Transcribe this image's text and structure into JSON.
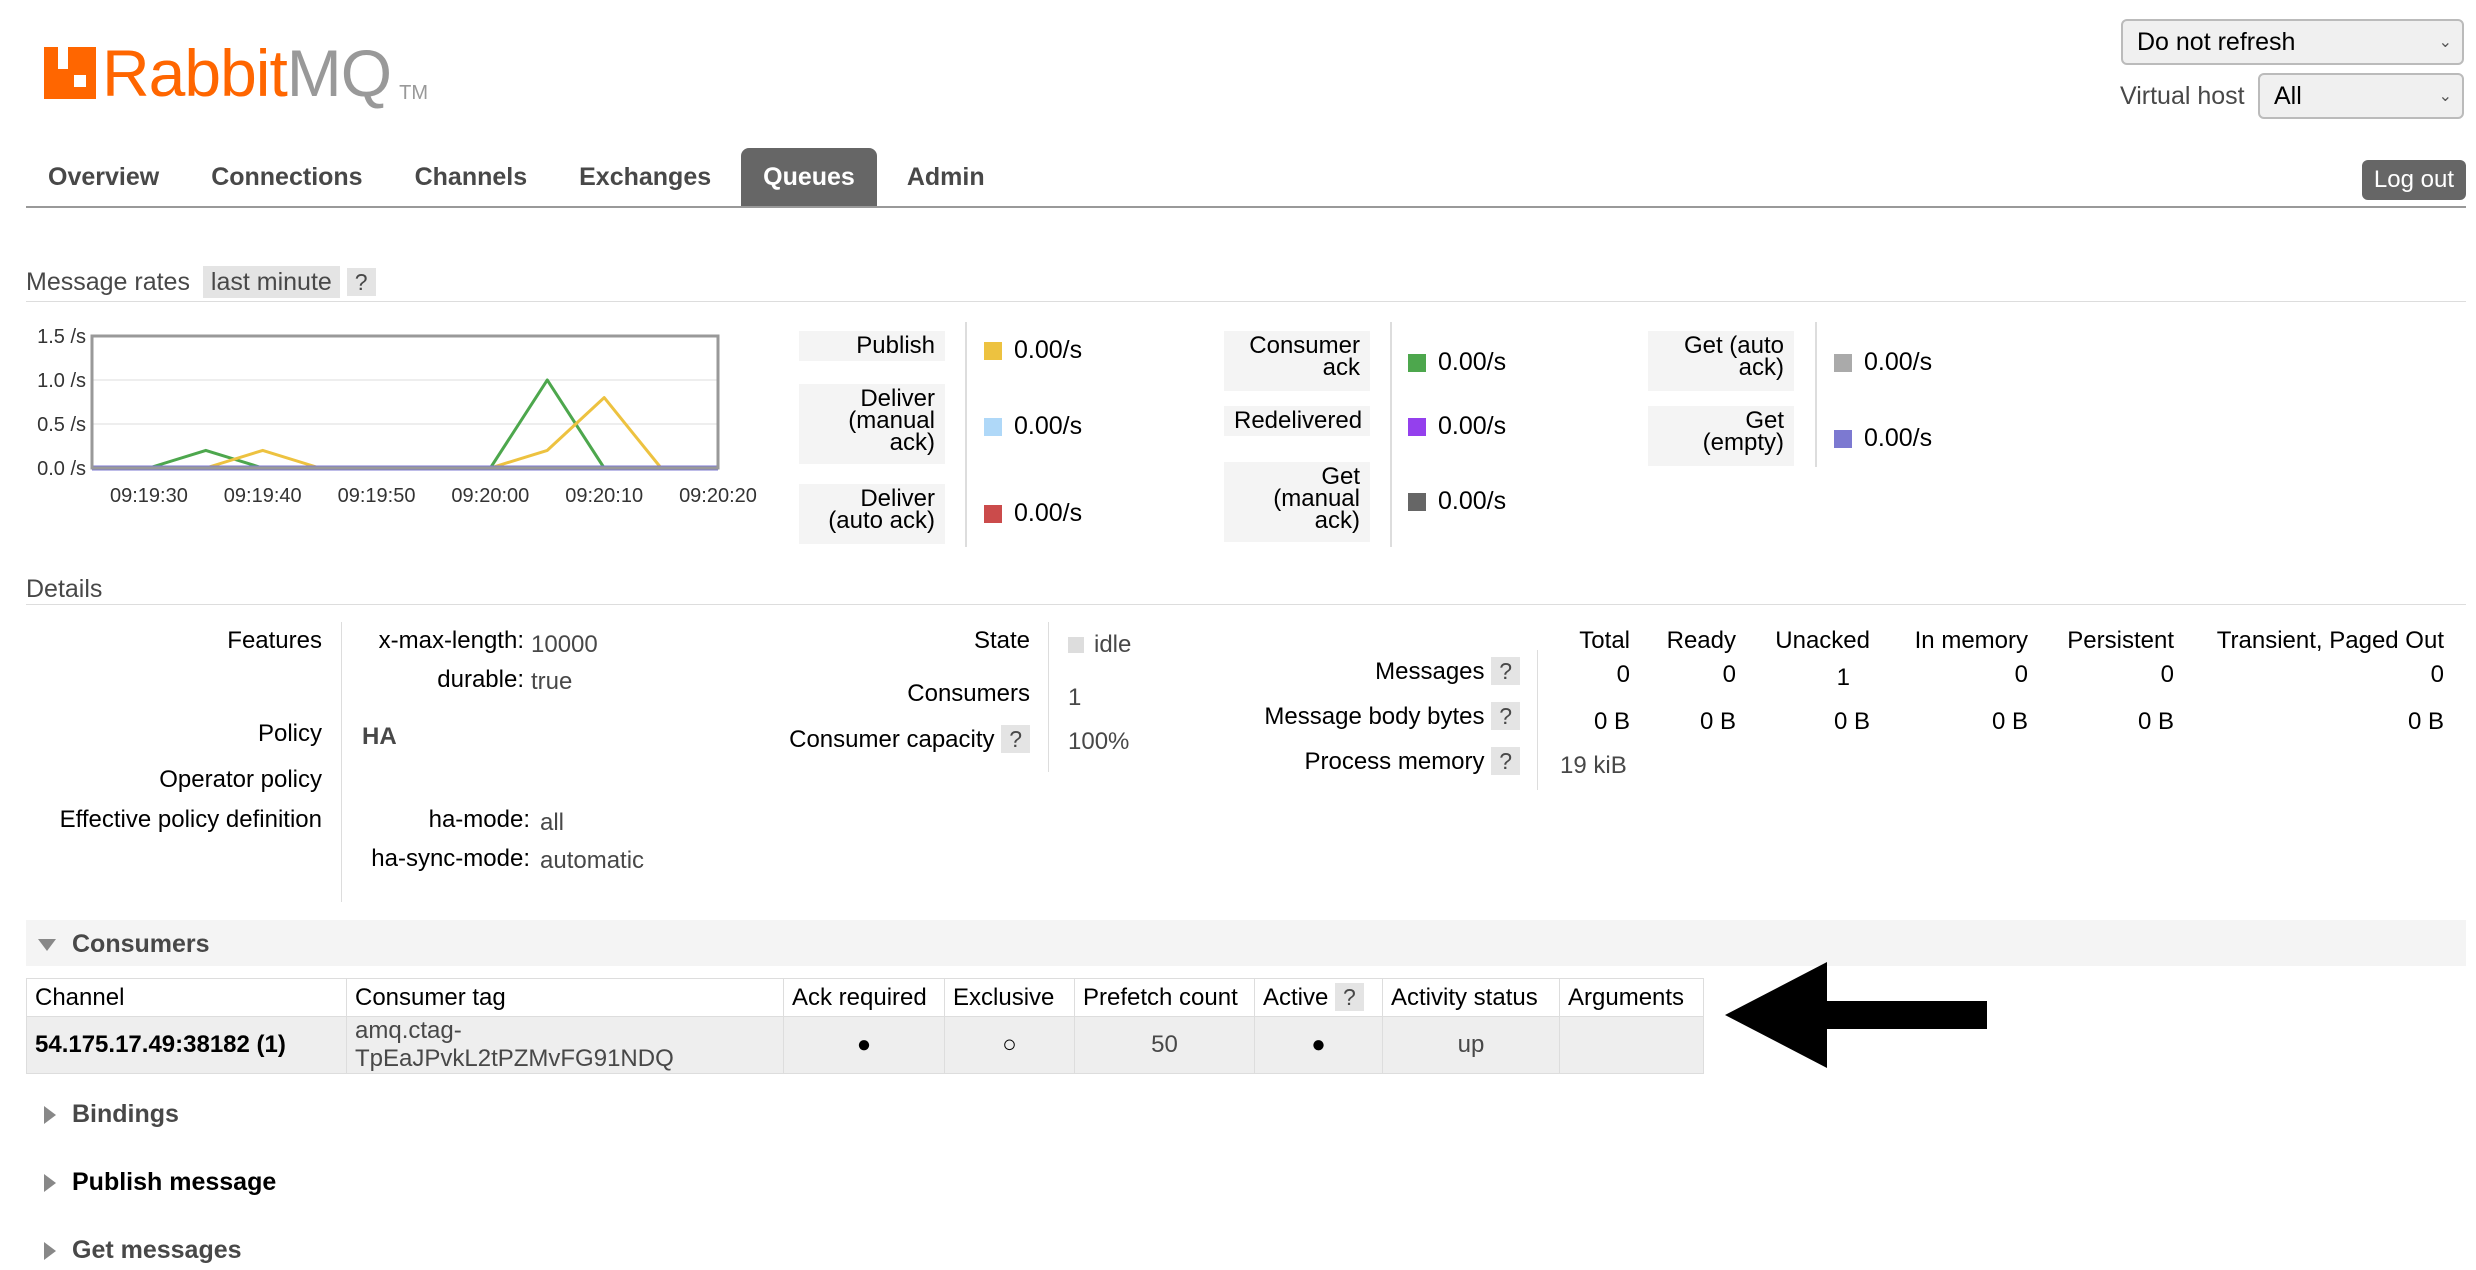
{
  "header": {
    "logo_text_orange": "Rabbit",
    "logo_text_gray": "MQ",
    "logo_tm": "TM",
    "refresh_select": "Do not refresh",
    "vhost_label": "Virtual host",
    "vhost_select": "All",
    "logout_label": "Log out"
  },
  "nav": {
    "items": [
      "Overview",
      "Connections",
      "Channels",
      "Exchanges",
      "Queues",
      "Admin"
    ],
    "active": "Queues"
  },
  "message_rates": {
    "title": "Message rates",
    "range": "last minute",
    "help": "?",
    "legend": [
      {
        "label": "Publish",
        "value": "0.00/s",
        "color": "#edc240"
      },
      {
        "label": "Deliver (manual ack)",
        "value": "0.00/s",
        "color": "#afd8f8"
      },
      {
        "label": "Deliver (auto ack)",
        "value": "0.00/s",
        "color": "#cb4b4b"
      },
      {
        "label": "Consumer ack",
        "value": "0.00/s",
        "color": "#4da74d"
      },
      {
        "label": "Redelivered",
        "value": "0.00/s",
        "color": "#9440ed"
      },
      {
        "label": "Get (manual ack)",
        "value": "0.00/s",
        "color": "#666666"
      },
      {
        "label": "Get (auto ack)",
        "value": "0.00/s",
        "color": "#aaaaaa"
      },
      {
        "label": "Get (empty)",
        "value": "0.00/s",
        "color": "#7c79d1"
      }
    ]
  },
  "chart_data": {
    "type": "line",
    "y_ticks": [
      "1.5 /s",
      "1.0 /s",
      "0.5 /s",
      "0.0 /s"
    ],
    "x_ticks": [
      "09:19:30",
      "09:19:40",
      "09:19:50",
      "09:20:00",
      "09:20:10",
      "09:20:20"
    ],
    "ylim": [
      0,
      1.5
    ],
    "x": [
      "09:19:25",
      "09:19:30",
      "09:19:35",
      "09:19:40",
      "09:19:45",
      "09:19:50",
      "09:19:55",
      "09:20:00",
      "09:20:05",
      "09:20:10",
      "09:20:15",
      "09:20:20"
    ],
    "series": [
      {
        "name": "Consumer ack",
        "color": "#4da74d",
        "values": [
          0,
          0,
          0.2,
          0,
          0,
          0,
          0,
          0,
          1.0,
          0,
          0,
          0
        ]
      },
      {
        "name": "Publish",
        "color": "#edc240",
        "values": [
          0,
          0,
          0,
          0.2,
          0,
          0,
          0,
          0,
          0.2,
          0.8,
          0,
          0
        ]
      },
      {
        "name": "Get (empty)",
        "color": "#7c79d1",
        "values": [
          0,
          0,
          0,
          0,
          0,
          0,
          0,
          0,
          0,
          0,
          0,
          0
        ]
      }
    ]
  },
  "details": {
    "title": "Details",
    "features_label": "Features",
    "features": [
      {
        "key": "x-max-length:",
        "value": "10000"
      },
      {
        "key": "durable:",
        "value": "true"
      }
    ],
    "policy_label": "Policy",
    "policy_value": "HA",
    "operator_policy_label": "Operator policy",
    "effective_policy_label": "Effective policy definition",
    "effective_policy": [
      {
        "key": "ha-mode:",
        "value": "all"
      },
      {
        "key": "ha-sync-mode:",
        "value": "automatic"
      }
    ],
    "state_label": "State",
    "state_value": "idle",
    "consumers_label": "Consumers",
    "consumers_value": "1",
    "consumer_capacity_label": "Consumer capacity",
    "consumer_capacity_value": "100%",
    "stats_headers": [
      "Total",
      "Ready",
      "Unacked",
      "In memory",
      "Persistent",
      "Transient, Paged Out"
    ],
    "messages_label": "Messages",
    "messages_values": [
      "0",
      "0",
      "1",
      "0",
      "0",
      "0"
    ],
    "body_bytes_label": "Message body bytes",
    "body_bytes_values": [
      "0 B",
      "0 B",
      "0 B",
      "0 B",
      "0 B",
      "0 B"
    ],
    "process_memory_label": "Process memory",
    "process_memory_value": "19 kiB",
    "help": "?"
  },
  "consumers": {
    "title": "Consumers",
    "headers": [
      "Channel",
      "Consumer tag",
      "Ack required",
      "Exclusive",
      "Prefetch count",
      "Active",
      "Activity status",
      "Arguments"
    ],
    "row": {
      "channel": "54.175.17.49:38182 (1)",
      "tag": "amq.ctag-TpEaJPvkL2tPZMvFG91NDQ",
      "ack_required": "●",
      "exclusive": "○",
      "prefetch": "50",
      "active": "●",
      "status": "up",
      "arguments": ""
    }
  },
  "sections": {
    "bindings": "Bindings",
    "publish": "Publish message",
    "get": "Get messages"
  }
}
